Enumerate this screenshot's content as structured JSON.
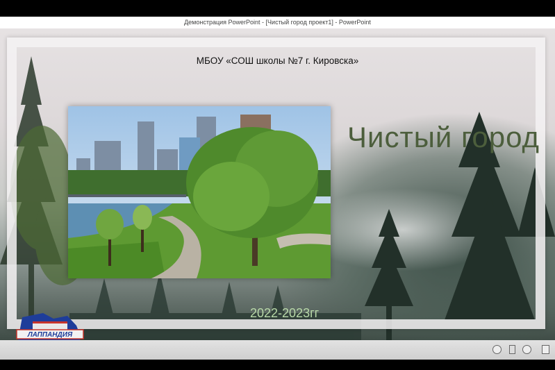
{
  "window": {
    "title": "Демонстрация PowerPoint - [Чистый город проект1] - PowerPoint"
  },
  "slide": {
    "school": "МБОУ «СОШ школы №7 г. Кировска»",
    "title": "Чистый город",
    "years": "2022-2023гг"
  },
  "logo": {
    "text": "ЛАППАНДИЯ"
  },
  "controls": {
    "prev": "prev-slide",
    "menu": "slide-menu",
    "next": "next-slide",
    "pause": "pause"
  }
}
